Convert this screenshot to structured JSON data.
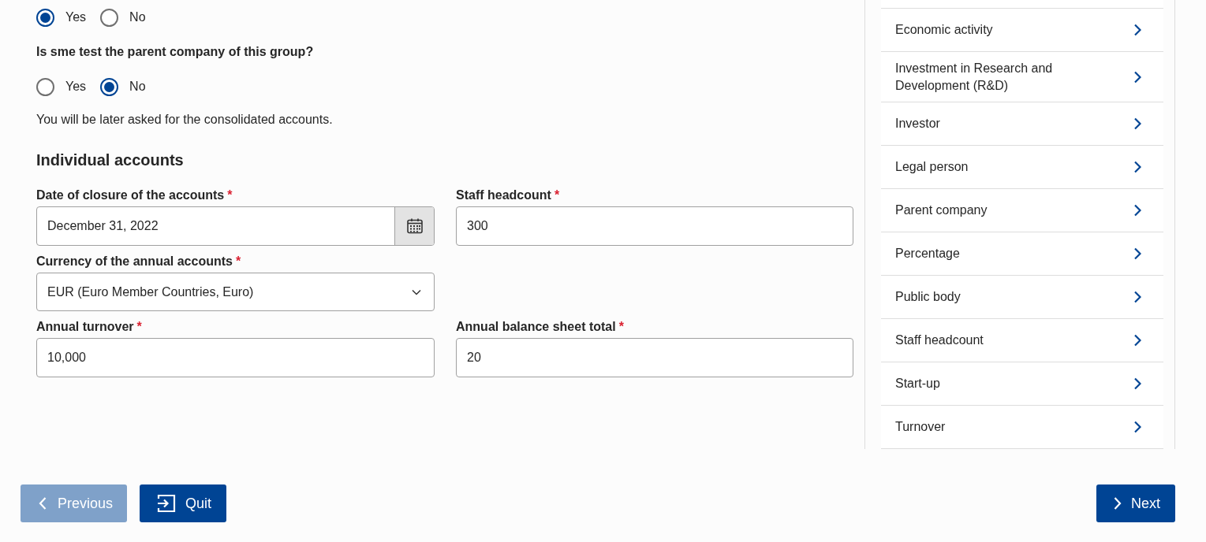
{
  "radio_groups": [
    {
      "options": [
        {
          "label": "Yes",
          "selected": true
        },
        {
          "label": "No",
          "selected": false
        }
      ]
    },
    {
      "question": "Is sme test the parent company of this group?",
      "options": [
        {
          "label": "Yes",
          "selected": false
        },
        {
          "label": "No",
          "selected": true
        }
      ],
      "note": "You will be later asked for the consolidated accounts."
    }
  ],
  "section_title": "Individual accounts",
  "fields": [
    {
      "kind": "date",
      "label": "Date of closure of the accounts",
      "required": true,
      "value": "December 31, 2022"
    },
    {
      "kind": "text",
      "label": "Staff headcount",
      "required": true,
      "value": "300"
    },
    {
      "kind": "select",
      "label": "Currency of the annual accounts",
      "required": true,
      "value": "EUR (Euro Member Countries, Euro)"
    },
    {
      "kind": "empty"
    },
    {
      "kind": "text",
      "label": "Annual turnover",
      "required": true,
      "value": "10,000"
    },
    {
      "kind": "text",
      "label": "Annual balance sheet total",
      "required": true,
      "value": "20"
    }
  ],
  "required_mark": "*",
  "sidebar": {
    "items": [
      "Economic activity",
      "Investment in Research and Development (R&D)",
      "Investor",
      "Legal person",
      "Parent company",
      "Percentage",
      "Public body",
      "Staff headcount",
      "Start-up",
      "Turnover"
    ]
  },
  "buttons": [
    {
      "kind": "previous",
      "label": "Previous",
      "disabled": true
    },
    {
      "kind": "quit",
      "label": "Quit",
      "disabled": false
    },
    {
      "kind": "next",
      "label": "Next",
      "disabled": false
    }
  ]
}
